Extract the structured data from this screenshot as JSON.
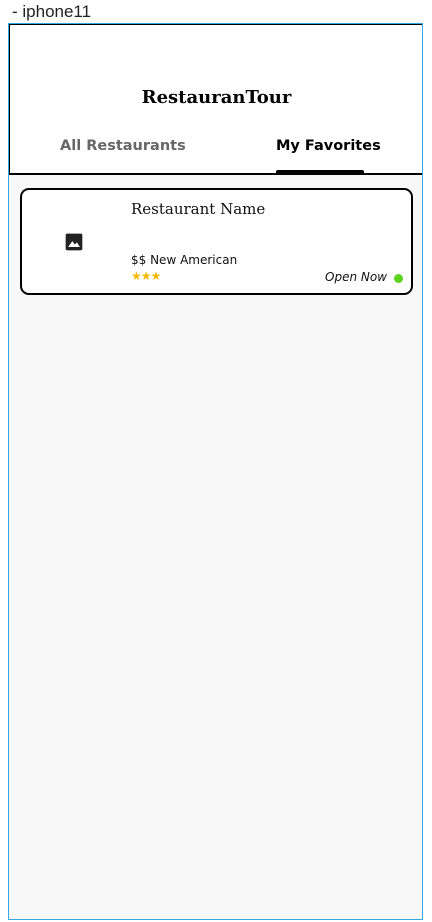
{
  "device": {
    "label": "- iphone11"
  },
  "header": {
    "title": "RestauranTour"
  },
  "tabs": [
    {
      "label": "All Restaurants",
      "active": false
    },
    {
      "label": "My Favorites",
      "active": true
    }
  ],
  "restaurants": [
    {
      "name": "Restaurant Name",
      "meta": "$$ New American",
      "rating": 3,
      "stars": "★★★",
      "status": "Open Now",
      "status_color": "#5ad21e",
      "image_icon": "image-icon"
    }
  ],
  "colors": {
    "frame_border": "#38a8e0",
    "background": "#f8f8f8",
    "star": "#f5b800",
    "active_tab": "#000000",
    "inactive_tab": "#666666"
  }
}
